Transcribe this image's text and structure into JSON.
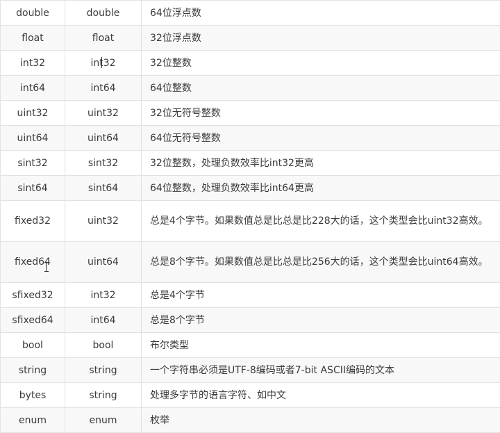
{
  "table": {
    "rows": [
      {
        "proto": "double",
        "go": "double",
        "desc": "64位浮点数"
      },
      {
        "proto": "float",
        "go": "float",
        "desc": "32位浮点数"
      },
      {
        "proto": "int32",
        "go": "int32",
        "desc": "32位整数"
      },
      {
        "proto": "int64",
        "go": "int64",
        "desc": "64位整数"
      },
      {
        "proto": "uint32",
        "go": "uint32",
        "desc": "32位无符号整数"
      },
      {
        "proto": "uint64",
        "go": "uint64",
        "desc": "64位无符号整数"
      },
      {
        "proto": "sint32",
        "go": "sint32",
        "desc": "32位整数，处理负数效率比int32更高"
      },
      {
        "proto": "sint64",
        "go": "sint64",
        "desc": "64位整数，处理负数效率比int64更高"
      },
      {
        "proto": "fixed32",
        "go": "uint32",
        "desc": "总是4个字节。如果数值总是比总是比228大的话，这个类型会比uint32高效。"
      },
      {
        "proto": "fixed64",
        "go": "uint64",
        "desc": "总是8个字节。如果数值总是比总是比256大的话，这个类型会比uint64高效。"
      },
      {
        "proto": "sfixed32",
        "go": "int32",
        "desc": "总是4个字节"
      },
      {
        "proto": "sfixed64",
        "go": "int64",
        "desc": "总是8个字节"
      },
      {
        "proto": "bool",
        "go": "bool",
        "desc": "布尔类型"
      },
      {
        "proto": "string",
        "go": "string",
        "desc": "一个字符串必须是UTF-8编码或者7-bit ASCII编码的文本"
      },
      {
        "proto": "bytes",
        "go": "string",
        "desc": "处理多字节的语言字符、如中文"
      },
      {
        "proto": "enum",
        "go": "enum",
        "desc": "枚举"
      }
    ]
  }
}
